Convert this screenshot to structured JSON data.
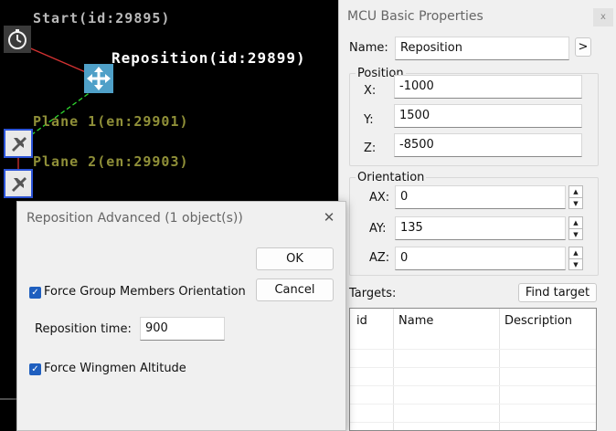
{
  "canvas": {
    "nodes": {
      "start": "Start(id:29895)",
      "reposition": "Reposition(id:29899)",
      "plane1": "Plane 1(en:29901)",
      "plane2": "Plane 2(en:29903)"
    }
  },
  "mcu_panel": {
    "title": "MCU Basic Properties",
    "close": "x",
    "name_label": "Name:",
    "name_value": "Reposition",
    "name_expand": ">",
    "position": {
      "group_label": "Position",
      "x_label": "X:",
      "x_value": "-1000",
      "y_label": "Y:",
      "y_value": "1500",
      "z_label": "Z:",
      "z_value": "-8500"
    },
    "orientation": {
      "group_label": "Orientation",
      "ax_label": "AX:",
      "ax_value": "0",
      "ay_label": "AY:",
      "ay_value": "135",
      "az_label": "AZ:",
      "az_value": "0"
    },
    "targets_label": "Targets:",
    "find_target_label": "Find target",
    "targets_columns": [
      "id",
      "Name",
      "Description"
    ]
  },
  "reposition_advanced": {
    "title": "Reposition Advanced (1 object(s))",
    "close": "✕",
    "ok_label": "OK",
    "cancel_label": "Cancel",
    "force_orientation_label": "Force Group Members Orientation",
    "force_orientation_checked": true,
    "reposition_time_label": "Reposition time:",
    "reposition_time_value": "900",
    "force_altitude_label": "Force Wingmen Altitude",
    "force_altitude_checked": true
  }
}
